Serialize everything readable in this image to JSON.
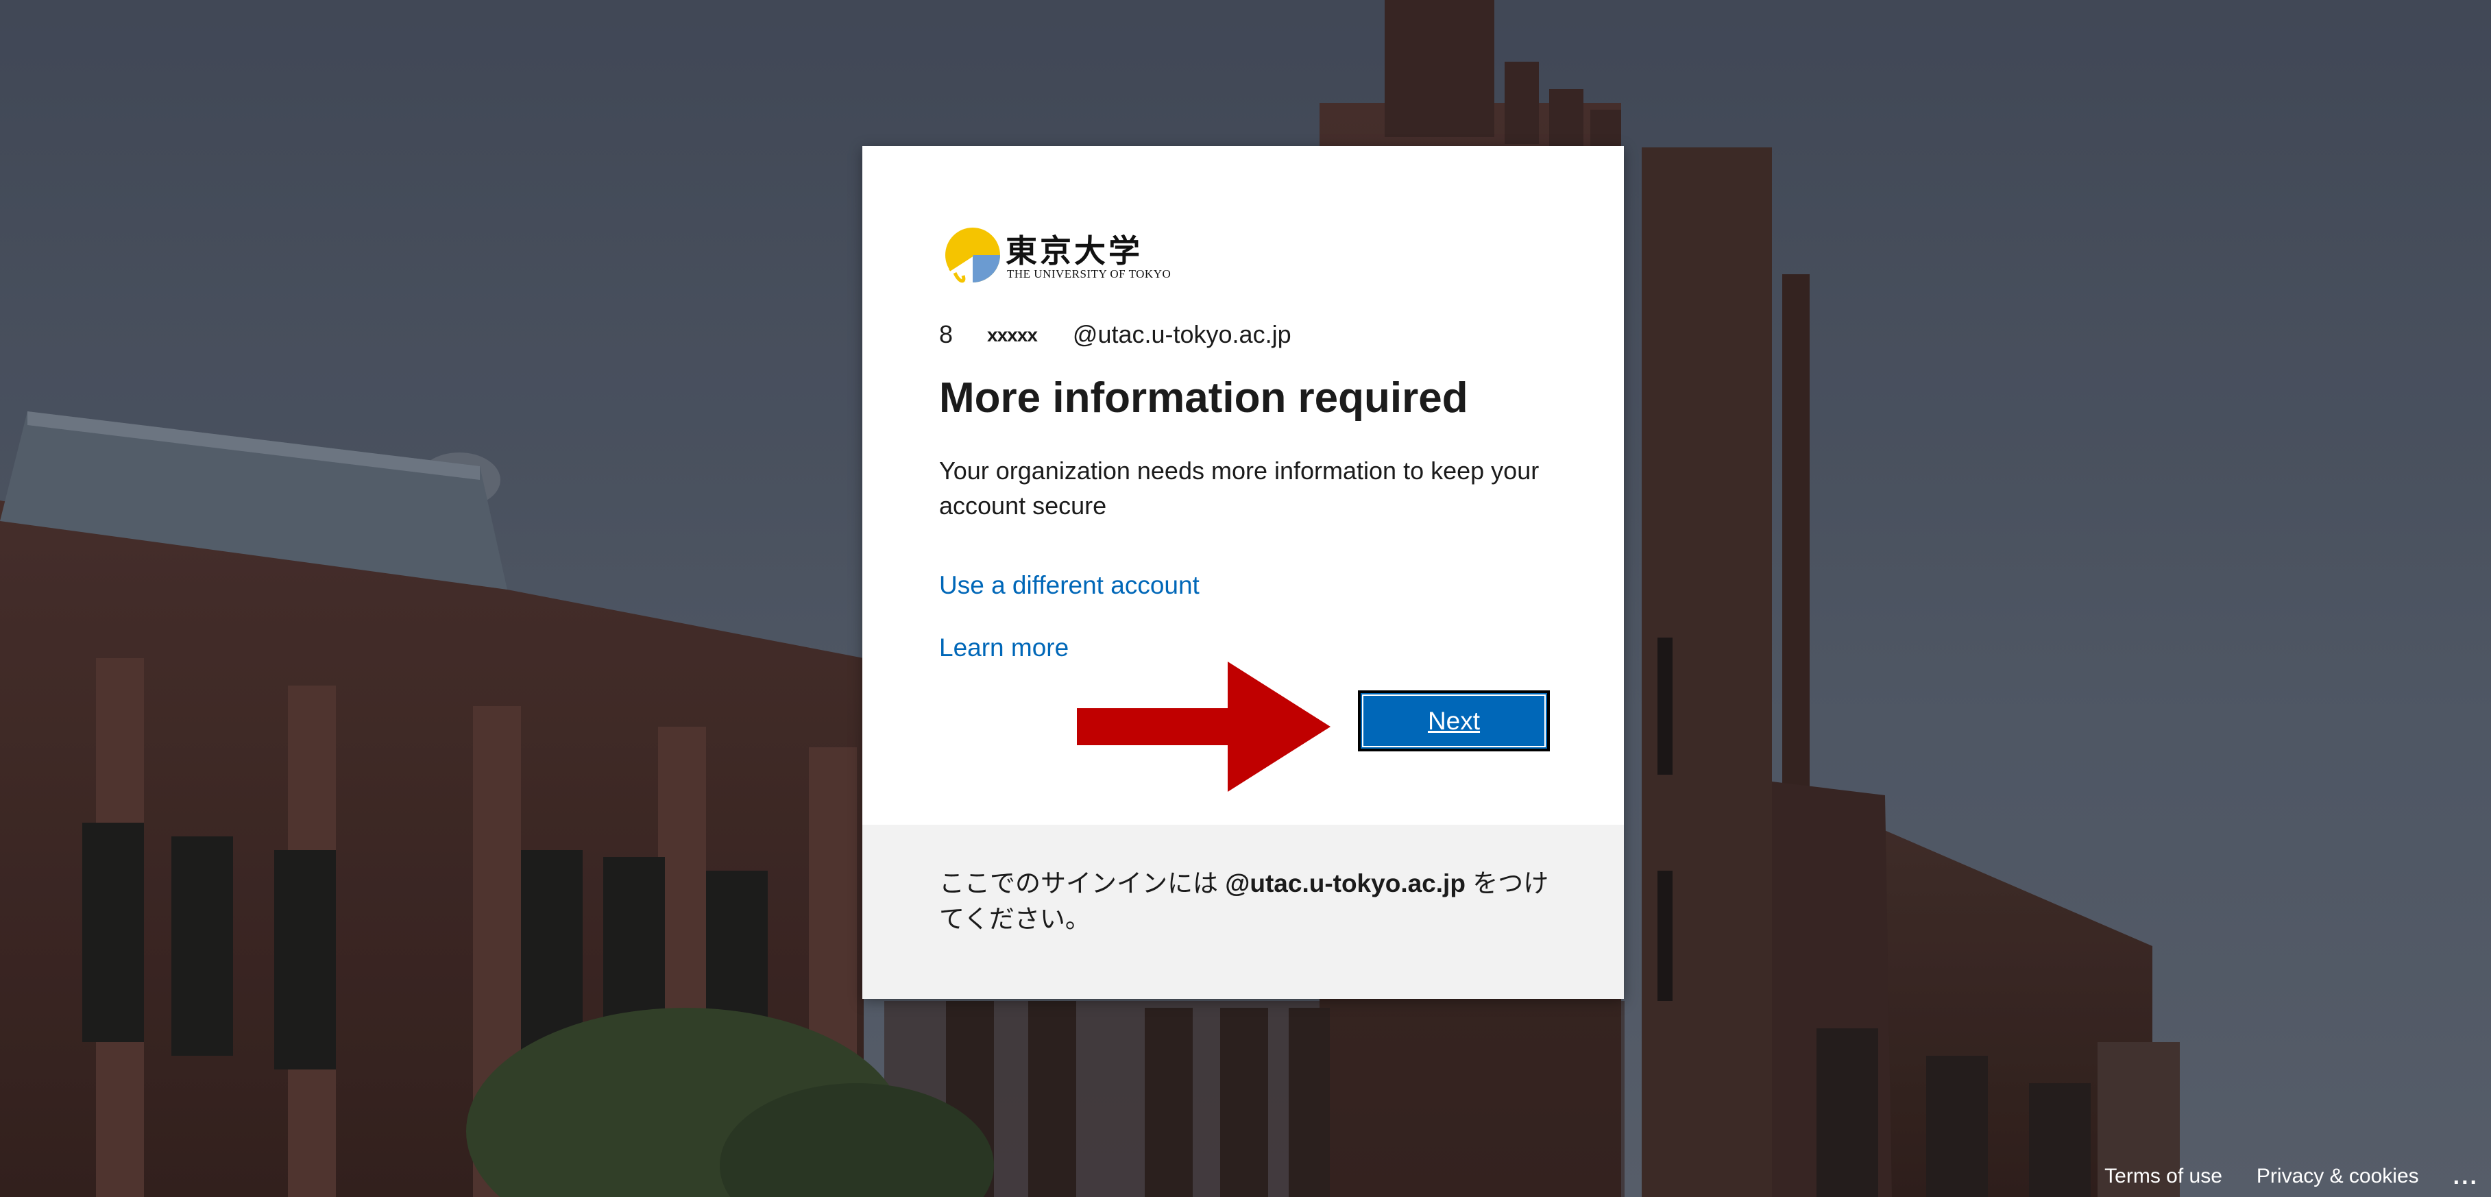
{
  "logo": {
    "text_jp": "東京大学",
    "text_en": "THE UNIVERSITY OF TOKYO"
  },
  "identity": {
    "prefix": "8",
    "mask": "xxxxx",
    "domain": "@utac.u-tokyo.ac.jp"
  },
  "title": "More information required",
  "description": "Your organization needs more information to keep your account secure",
  "links": {
    "different_account": "Use a different account",
    "learn_more": "Learn more"
  },
  "next_button": "Next",
  "footer_note": {
    "before": "ここでのサインインには ",
    "domain": "@utac.u-tokyo.ac.jp",
    "after": " をつけてください。"
  },
  "page_footer": {
    "terms": "Terms of use",
    "privacy": "Privacy & cookies",
    "more": "..."
  },
  "colors": {
    "accent": "#0067b8",
    "arrow": "#c00000",
    "logo_gold": "#f5c400",
    "logo_blue": "#6b9bd1"
  },
  "icons": {
    "logo": "ginkgo-leaf-icon",
    "arrow": "red-pointer-arrow-icon"
  }
}
